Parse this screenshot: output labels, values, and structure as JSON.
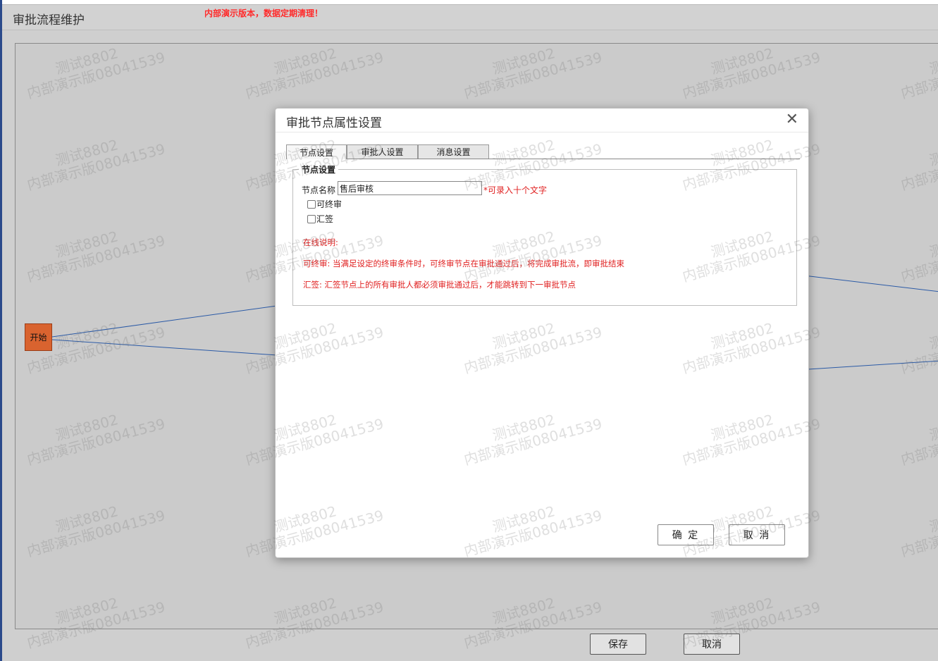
{
  "page": {
    "title": "审批流程维护",
    "demo_warning": "内部演示版本，数据定期清理！"
  },
  "flow": {
    "start_node_label": "开始"
  },
  "bottom_buttons": {
    "save_label": "保存",
    "cancel_label": "取消"
  },
  "watermark": {
    "line1": "测试8802",
    "line2": "内部演示版08041539"
  },
  "modal": {
    "title": "审批节点属性设置",
    "close_glyph": "✕",
    "tabs": [
      {
        "label": "节点设置",
        "active": true
      },
      {
        "label": "审批人设置",
        "active": false
      },
      {
        "label": "消息设置",
        "active": false
      }
    ],
    "node_settings": {
      "legend": "节点设置",
      "name_label": "节点名称",
      "name_value": "售后审核",
      "name_hint": "*可录入十个文字",
      "final_approval_label": "可终审",
      "final_approval_checked": false,
      "countersign_label": "汇签",
      "countersign_checked": false,
      "help_title": "在线说明:",
      "help_final": "可终审:   当满足设定的终审条件时，可终审节点在审批通过后，将完成审批流，即审批结束",
      "help_countersign": "汇签:   汇签节点上的所有审批人都必须审批通过后，才能跳转到下一审批节点"
    },
    "confirm_label": "确 定",
    "cancel_label": "取 消"
  },
  "colors": {
    "accent_red": "#e02020",
    "start_node": "#d9632f",
    "flow_line": "#2b5aa6",
    "canvas_bg": "#cbcbcb"
  }
}
